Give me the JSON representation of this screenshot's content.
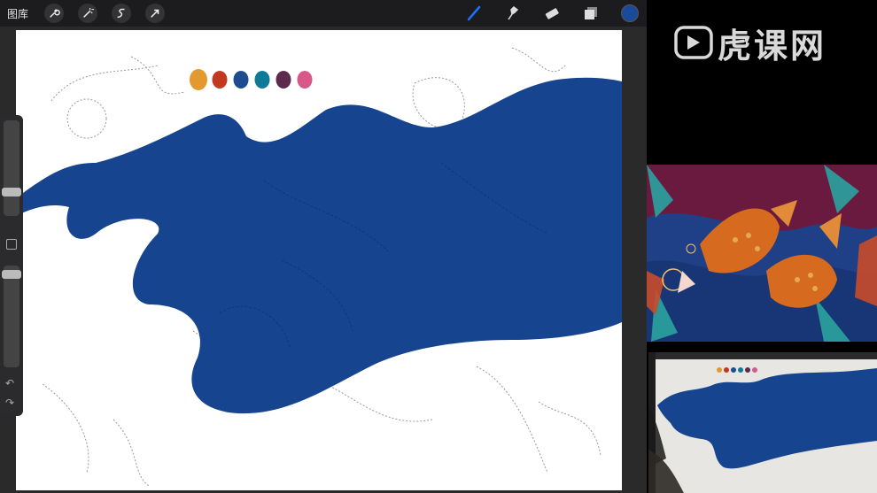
{
  "toolbar": {
    "gallery_label": "图库",
    "left_tools": [
      "wrench-icon",
      "magic-wand-icon",
      "selection-icon",
      "transform-arrow-icon"
    ],
    "right_tools": [
      "brush-icon",
      "smudge-icon",
      "eraser-icon",
      "layers-icon"
    ],
    "current_color": "#1b4a9a"
  },
  "canvas": {
    "palette": [
      "#e29a2e",
      "#c2391f",
      "#1d4d8f",
      "#0e7a98",
      "#5c2a4c",
      "#d9588a"
    ],
    "fill_color": "#16448e"
  },
  "watermark": {
    "text": "虎课网"
  },
  "colors": {
    "toolbar_bg": "#1c1c1e",
    "accent": "#1e6fff"
  }
}
